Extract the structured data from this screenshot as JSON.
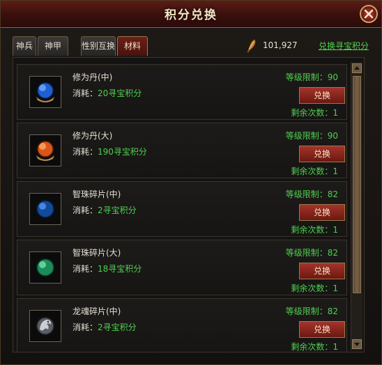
{
  "window": {
    "title": "积分兑换"
  },
  "tabs": [
    {
      "label": "神兵"
    },
    {
      "label": "神甲"
    },
    {
      "label": "性别互换"
    },
    {
      "label": "材料"
    }
  ],
  "active_tab": "材料",
  "currency": {
    "icon": "quill-icon",
    "value": "101,927"
  },
  "exchange_link": "兑换寻宝积分",
  "items": [
    {
      "name": "修为丹(中)",
      "cost_label": "消耗：",
      "cost": "20寻宝积分",
      "level_limit": "等级限制：90",
      "button": "兑换",
      "remaining": "剩余次数：1",
      "icon": "blue-cultivation-pill-icon"
    },
    {
      "name": "修为丹(大)",
      "cost_label": "消耗：",
      "cost": "190寻宝积分",
      "level_limit": "等级限制：90",
      "button": "兑换",
      "remaining": "剩余次数：1",
      "icon": "orange-cultivation-pill-icon"
    },
    {
      "name": "智珠碎片(中)",
      "cost_label": "消耗：",
      "cost": "2寻宝积分",
      "level_limit": "等级限制：82",
      "button": "兑换",
      "remaining": "剩余次数：1",
      "icon": "blue-orb-icon"
    },
    {
      "name": "智珠碎片(大)",
      "cost_label": "消耗：",
      "cost": "18寻宝积分",
      "level_limit": "等级限制：82",
      "button": "兑换",
      "remaining": "剩余次数：1",
      "icon": "green-orb-icon"
    },
    {
      "name": "龙魂碎片(中)",
      "cost_label": "消耗：",
      "cost": "2寻宝积分",
      "level_limit": "等级限制：82",
      "button": "兑换",
      "remaining": "剩余次数：1",
      "icon": "dragon-soul-icon"
    }
  ],
  "colors": {
    "highlight_green": "#4fd04f",
    "title_bar": "#4a1410",
    "button_red": "#8c2319"
  }
}
